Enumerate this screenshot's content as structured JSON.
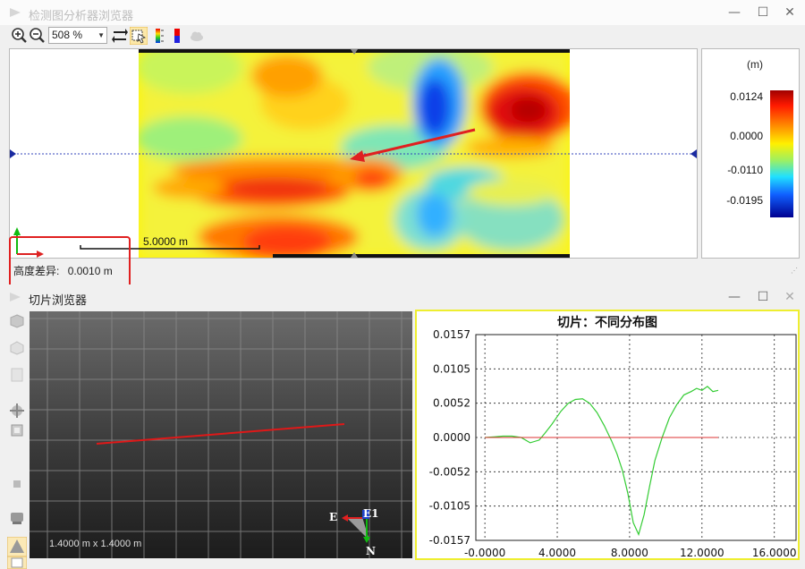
{
  "top_window": {
    "title": "检测图分析器浏览器",
    "zoom": "508 %",
    "scale_bar": "5.0000 m",
    "height_diff_label": "高度差异:",
    "height_diff_value": "0.0010 m",
    "legend": {
      "unit": "(m)",
      "labels": [
        "0.0124",
        "0.0000",
        "-0.0110",
        "-0.0195"
      ]
    }
  },
  "bottom_window": {
    "title": "切片浏览器",
    "view3d": {
      "dims": "1.4000 m x 1.4000 m",
      "axis_labels": {
        "east": "E",
        "north": "N",
        "e_box": "E1"
      }
    }
  },
  "chart_data": {
    "type": "line",
    "title": "切片：不同分布图",
    "xlim": [
      -0.5,
      17.2
    ],
    "ylim": [
      -0.0157,
      0.0157
    ],
    "x_ticks": [
      "-0.0000",
      "4.0000",
      "8.0000",
      "12.0000",
      "16.0000"
    ],
    "y_ticks": [
      "0.0157",
      "0.0105",
      "0.0052",
      "0.0000",
      "-0.0052",
      "-0.0105",
      "-0.0157"
    ],
    "grid": true,
    "series": [
      {
        "color": "#33cc33",
        "x": [
          0.0,
          0.5,
          1.0,
          1.5,
          2.0,
          2.5,
          3.0,
          3.3,
          3.7,
          4.2,
          4.6,
          5.0,
          5.4,
          5.8,
          6.2,
          6.6,
          7.0,
          7.3,
          7.6,
          7.9,
          8.2,
          8.5,
          8.8,
          9.1,
          9.4,
          9.8,
          10.2,
          10.6,
          11.0,
          11.4,
          11.7,
          12.0,
          12.3,
          12.6,
          12.9
        ],
        "y": [
          0.0,
          0.0001,
          0.0002,
          0.0002,
          0.0,
          -0.0008,
          -0.0004,
          0.0006,
          0.002,
          0.004,
          0.0052,
          0.0058,
          0.0059,
          0.0052,
          0.0038,
          0.0018,
          -0.0005,
          -0.0025,
          -0.005,
          -0.0085,
          -0.013,
          -0.0148,
          -0.0118,
          -0.0075,
          -0.0035,
          0.0,
          0.003,
          0.005,
          0.0065,
          0.007,
          0.0075,
          0.0072,
          0.0078,
          0.007,
          0.0072
        ]
      },
      {
        "color": "#dd3333",
        "x": [
          0.0,
          12.9
        ],
        "y": [
          0.0,
          0.0
        ]
      }
    ]
  }
}
